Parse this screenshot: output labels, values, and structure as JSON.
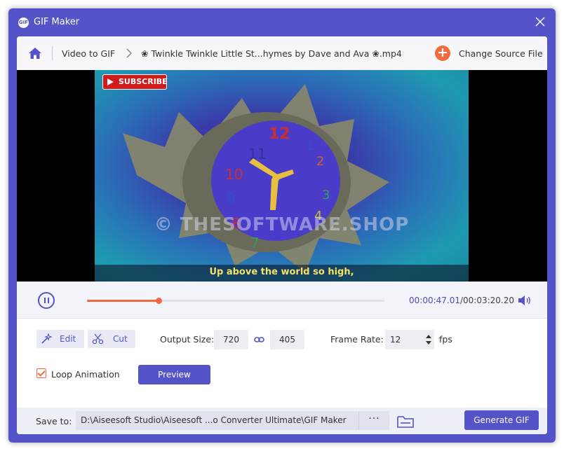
{
  "window": {
    "title": "GIF Maker",
    "logo_text": "GIF"
  },
  "breadcrumb": {
    "root": "Video to GIF",
    "file": "❀ Twinkle Twinkle Little St...hymes by Dave and Ava ❀.mp4",
    "change_source_label": "Change Source File"
  },
  "video": {
    "subscribe_label": "SUBSCRIBE",
    "watermark": "© THESOFTWARE.SHOP",
    "caption": "Up above the world so high,"
  },
  "player": {
    "current_time": "00:00:47.01",
    "total_time": "/00:03:20.20",
    "progress_fraction": 0.24
  },
  "settings": {
    "edit_label": "Edit",
    "cut_label": "Cut",
    "output_size_label": "Output Size:",
    "width": "720",
    "height": "405",
    "frame_rate_label": "Frame Rate:",
    "frame_rate": "12",
    "fps_label": "fps",
    "loop_label": "Loop Animation",
    "loop_checked": true,
    "preview_label": "Preview"
  },
  "footer": {
    "save_to_label": "Save to:",
    "path": "D:\\Aiseesoft Studio\\Aiseesoft ...o Converter Ultimate\\GIF Maker",
    "dots_label": "···",
    "generate_label": "Generate GIF"
  },
  "colors": {
    "accent": "#5454c8",
    "orange": "#f26a3d"
  }
}
